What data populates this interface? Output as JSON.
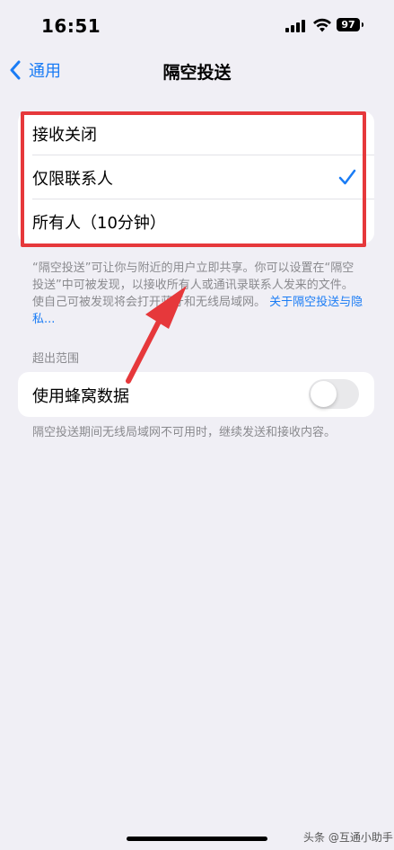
{
  "status_bar": {
    "time": "16:51",
    "battery": "97"
  },
  "nav": {
    "back_label": "通用",
    "title": "隔空投送"
  },
  "options": [
    {
      "label": "接收关闭",
      "selected": false
    },
    {
      "label": "仅限联系人",
      "selected": true
    },
    {
      "label": "所有人（10分钟）",
      "selected": false
    }
  ],
  "footnote_1": {
    "text": "“隔空投送”可让你与附近的用户立即共享。你可以设置在“隔空投送”中可被发现，以接收所有人或通讯录联系人发来的文件。使自己可被发现将会打开蓝牙和无线局域网。",
    "link": "关于隔空投送与隐私..."
  },
  "out_of_range": {
    "header": "超出范围",
    "cellular_label": "使用蜂窝数据",
    "cellular_enabled": false,
    "footnote": "隔空投送期间无线局域网不可用时，继续发送和接收内容。"
  },
  "watermark": "头条 @互通小助手",
  "colors": {
    "accent": "#1a7cf5",
    "highlight": "#e6383b",
    "background": "#f0eff5"
  },
  "icons": [
    "signal-icon",
    "wifi-icon",
    "battery-icon",
    "chevron-left-icon",
    "checkmark-icon",
    "annotation-arrow"
  ]
}
